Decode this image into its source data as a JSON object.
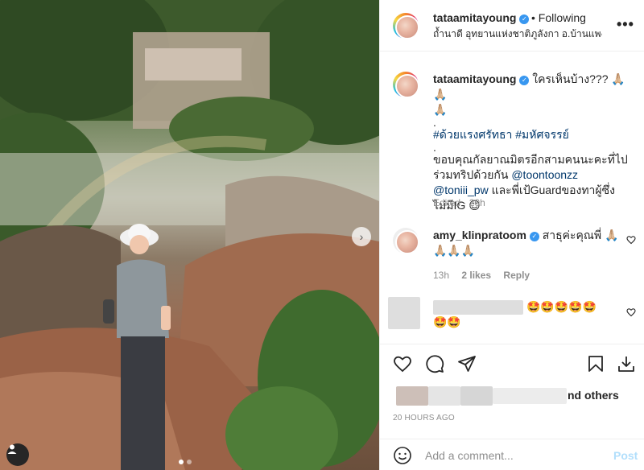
{
  "post": {
    "username": "tataamitayoung",
    "follow_status": "• Following",
    "location": "ถ้ำนาดี อุทยานแห่งชาติภูลังกา อ.บ้านแพง ...",
    "more_label": "•••"
  },
  "caption": {
    "username": "tataamitayoung",
    "line1": "ใครเห็นบ้าง??? 🙏🏼🙏🏼",
    "line1b": "🙏🏼",
    "dot1": ".",
    "hashtag1": "#ด้วยแรงศรัทธา",
    "hashtag2": "#มหัศจรรย์",
    "dot2": ".",
    "thanks_before": "ขอบคุณกัลยาณมิตรอีกสามคนนะคะที่ไปร่วมทริปด้วยกัน",
    "mention1": "@toontoonzz",
    "mention2": "@toniii_pw",
    "thanks_after": "และพี่เป้Guardของทาผู้ซึ่งไม่มีIG 😊",
    "edited": "Edited",
    "age": "20h"
  },
  "comments": [
    {
      "username": "amy_klinpratoom",
      "text_line1": "สาธุค่ะคุณพี่ 🙏🏼",
      "text_line2": "🙏🏼🙏🏼🙏🏼",
      "age": "13h",
      "likes": "2 likes",
      "reply": "Reply"
    },
    {
      "emoji_line1": "🤩🤩🤩🤩🤩",
      "emoji_line2": "🤩🤩"
    }
  ],
  "likes": {
    "tail": "nd others"
  },
  "timestamp": "20 HOURS AGO",
  "composer": {
    "placeholder": "Add a comment...",
    "post_label": "Post"
  },
  "photo": {
    "next_arrow": "›",
    "slide_count": 2,
    "active_slide": 1
  },
  "icons": [
    "heart-icon",
    "comment-icon",
    "share-icon",
    "bookmark-icon",
    "download-icon",
    "emoji-icon",
    "chevron-right-icon",
    "user-tag-icon",
    "more-icon"
  ]
}
